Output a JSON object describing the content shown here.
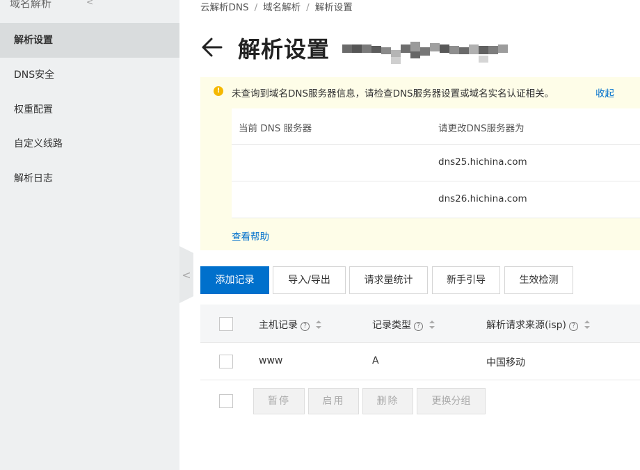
{
  "sidebar": {
    "header": "域名解析",
    "collapse_glyph": "<",
    "items": [
      {
        "label": "解析设置",
        "active": true
      },
      {
        "label": "DNS安全",
        "active": false
      },
      {
        "label": "权重配置",
        "active": false
      },
      {
        "label": "自定义线路",
        "active": false
      },
      {
        "label": "解析日志",
        "active": false
      }
    ],
    "toggle_glyph": "<"
  },
  "breadcrumb": [
    "云解析DNS",
    "域名解析",
    "解析设置"
  ],
  "page": {
    "title": "解析设置"
  },
  "alert": {
    "message": "未查询到域名DNS服务器信息，请检查DNS服务器设置或域名实名认证相关。",
    "collapse_label": "收起",
    "table": {
      "headers": [
        "当前 DNS 服务器",
        "请更改DNS服务器为"
      ],
      "rows": [
        [
          "",
          "dns25.hichina.com"
        ],
        [
          "",
          "dns26.hichina.com"
        ]
      ]
    },
    "help_label": "查看帮助"
  },
  "toolbar": {
    "buttons": [
      "添加记录",
      "导入/导出",
      "请求量统计",
      "新手引导",
      "生效检测"
    ]
  },
  "records": {
    "columns": [
      "主机记录",
      "记录类型",
      "解析请求来源(isp)"
    ],
    "rows": [
      {
        "host": "www",
        "type": "A",
        "isp": "中国移动"
      }
    ],
    "bulk_actions": [
      "暂停",
      "启用",
      "删除",
      "更换分组"
    ]
  },
  "colors": {
    "primary": "#0070cc",
    "alert_bg": "#fefde8",
    "warning_icon": "#f5b800",
    "sidebar_bg": "#eef0f1"
  }
}
